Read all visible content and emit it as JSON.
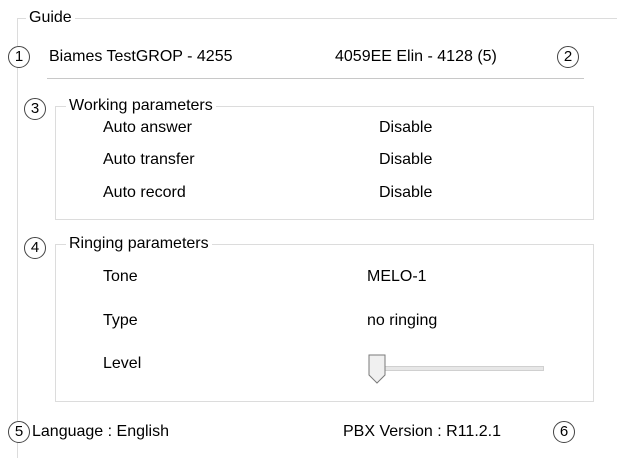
{
  "guide": {
    "title": "Guide",
    "left_party": "Biames TestGROP - 4255",
    "right_party": "4059EE Elin - 4128 (5)"
  },
  "markers": [
    "1",
    "2",
    "3",
    "4",
    "5",
    "6"
  ],
  "working": {
    "title": "Working parameters",
    "rows": [
      {
        "label": "Auto answer",
        "value": "Disable"
      },
      {
        "label": "Auto transfer",
        "value": "Disable"
      },
      {
        "label": "Auto record",
        "value": "Disable"
      }
    ]
  },
  "ringing": {
    "title": "Ringing parameters",
    "tone_label": "Tone",
    "tone_value": "MELO-1",
    "type_label": "Type",
    "type_value": "no ringing",
    "level_label": "Level",
    "level_fraction": 0
  },
  "footer": {
    "language": "Language : English",
    "pbx_version": "PBX Version : R11.2.1"
  }
}
